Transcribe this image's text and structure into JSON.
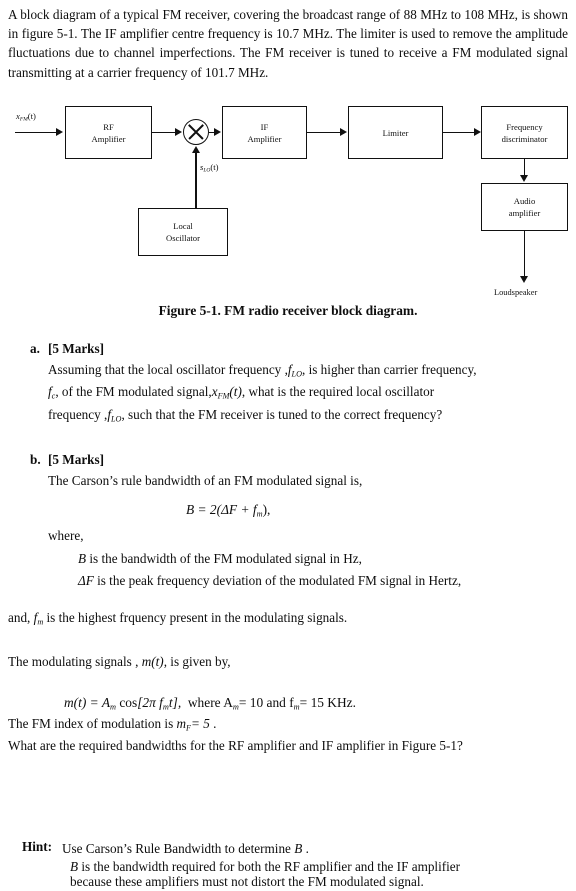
{
  "document": {
    "intro_paragraph": "A block diagram of a typical FM receiver, covering the broadcast range of 88 MHz to 108 MHz, is shown in figure 5-1.  The IF amplifier centre frequency is 10.7 MHz.  The limiter is used to remove the amplitude fluctuations due to channel imperfections.  The FM receiver is tuned to receive a FM modulated signal transmitting at a carrier frequency of 101.7 MHz.",
    "figure": {
      "caption": "Figure 5-1.  FM radio receiver block diagram.",
      "input_signal_label": "x",
      "input_signal_sub": "FM",
      "input_signal_arg": "(t)",
      "lo_signal_label": "s",
      "lo_signal_sub": "LO",
      "lo_signal_arg": "(t)",
      "blocks": [
        {
          "id": "rf-amplifier",
          "line1": "RF",
          "line2": "Amplifier"
        },
        {
          "id": "mixer",
          "line1": "",
          "line2": ""
        },
        {
          "id": "if-amplifier",
          "line1": "IF",
          "line2": "Amplifier"
        },
        {
          "id": "limiter",
          "line1": "Limiter",
          "line2": ""
        },
        {
          "id": "frequency-discriminator",
          "line1": "Frequency",
          "line2": "discriminator"
        },
        {
          "id": "local-oscillator",
          "line1": "Local",
          "line2": "Oscillator"
        },
        {
          "id": "audio-amplifier",
          "line1": "Audio",
          "line2": "amplifier"
        }
      ],
      "output_label": "Loudspeaker"
    },
    "part_a": {
      "letter": "a.",
      "marks": "[5 Marks]",
      "line1_pre": "Assuming that the local oscillator frequency ,",
      "line1_sym": "f",
      "line1_sub": "LO",
      "line1_post": ",  is higher than carrier frequency,",
      "line2_sym": "f",
      "line2_sub": "c",
      "line2_mid": ",   of the FM modulated signal,",
      "line2_sym2": "x",
      "line2_sub2": "FM",
      "line2_arg2": "(t)",
      "line2_post": ",  what is the required local oscillator",
      "line3_pre": "frequency ,",
      "line3_sym": "f",
      "line3_sub": "LO",
      "line3_post": ", such that the FM receiver is tuned to the correct frequency?"
    },
    "part_b": {
      "letter": "b.",
      "marks": "[5 Marks]",
      "intro": "The Carson’s rule bandwidth of an FM modulated signal is,",
      "equation": "B = 2(ΔF + f",
      "equation_sub": "m",
      "equation_tail": "),",
      "where_label": "where,",
      "def_b_sym": "B",
      "def_b_text": "is the bandwidth of the FM modulated signal in Hz,",
      "def_df_sym": "ΔF",
      "def_df_text": "is the peak frequency deviation of the modulated FM signal in Hertz,",
      "def_fm_pre": "and,",
      "def_fm_sym": "f",
      "def_fm_sub": "m",
      "def_fm_text": "is the highest frquency present in the modulating signals.",
      "mod_intro_pre": "The modulating signals ,",
      "mod_intro_sym": "m",
      "mod_intro_arg": "(t)",
      "mod_intro_post": ", is given by,",
      "mod_equation_lhs_sym": "m",
      "mod_equation_lhs_arg": "(t)",
      "mod_equation_rhs": "= A",
      "mod_equation_rhs_sub": "m",
      "mod_equation_cos": "cos",
      "mod_equation_bracket": "[2π f",
      "mod_equation_bracket_sub": "m",
      "mod_equation_bracket_tail": "t],",
      "mod_equation_where": "where A",
      "mod_equation_where_sub": "m",
      "mod_equation_where_val": "= 10 and f",
      "mod_equation_where_sub2": "m",
      "mod_equation_where_val2": "= 15 KHz.",
      "index_pre": "The FM index of modulation is",
      "index_sym": "m",
      "index_sub": "F",
      "index_val": "= 5",
      "index_post": ".",
      "question": "What are the required bandwidths for the RF amplifier and IF amplifier in Figure 5-1?"
    },
    "hint": {
      "label": "Hint:",
      "line1_pre": "Use Carson’s Rule Bandwidth to determine",
      "line1_sym": "B",
      "line1_post": ".",
      "line2_sym": "B",
      "line2_text": "is the bandwidth required for both the RF amplifier and the IF amplifier",
      "line3_text": "because these amplifiers must not distort the FM modulated signal."
    }
  }
}
